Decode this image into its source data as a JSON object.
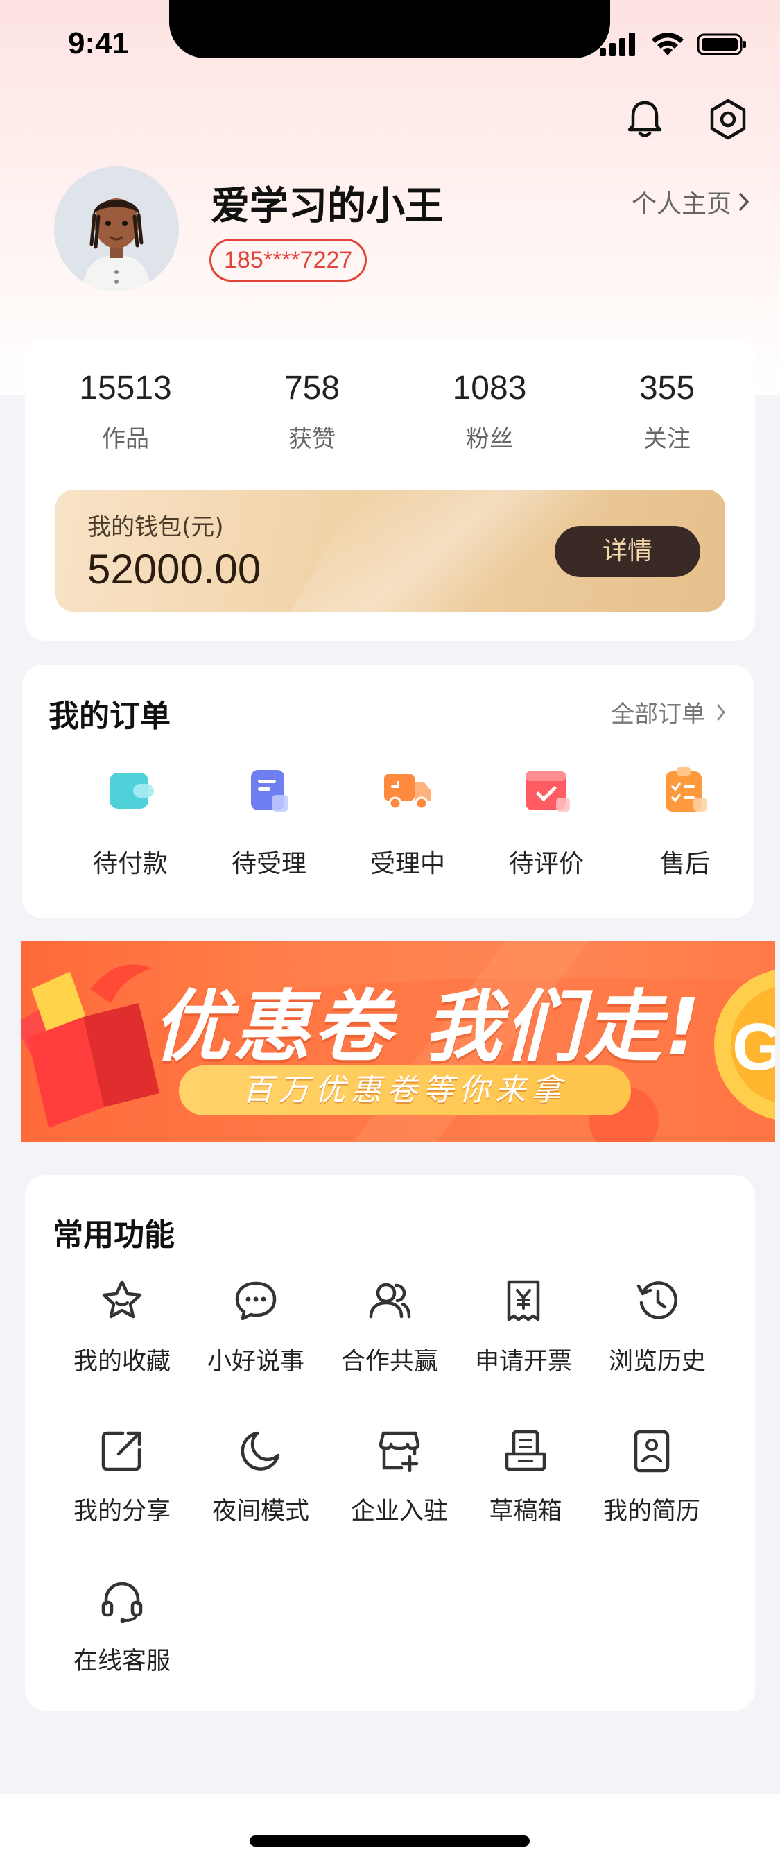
{
  "status_bar": {
    "time": "9:41"
  },
  "header": {
    "bell_icon": "bell-icon",
    "settings_icon": "settings-icon"
  },
  "profile": {
    "username": "爱学习的小王",
    "phone": "185****7227",
    "home_link": "个人主页"
  },
  "stats": [
    {
      "value": "15513",
      "label": "作品"
    },
    {
      "value": "758",
      "label": "获赞"
    },
    {
      "value": "1083",
      "label": "粉丝"
    },
    {
      "value": "355",
      "label": "关注"
    }
  ],
  "wallet": {
    "label": "我的钱包(元)",
    "amount": "52000.00",
    "button": "详情"
  },
  "orders": {
    "title": "我的订单",
    "link": "全部订单",
    "items": [
      {
        "label": "待付款",
        "icon": "wallet-icon",
        "color": "#4fd1d9"
      },
      {
        "label": "待受理",
        "icon": "document-icon",
        "color": "#6f7ef0"
      },
      {
        "label": "受理中",
        "icon": "truck-icon",
        "color": "#ff8a3d"
      },
      {
        "label": "待评价",
        "icon": "rating-box-icon",
        "color": "#ff5b63"
      },
      {
        "label": "售后",
        "icon": "clipboard-icon",
        "color": "#ff9a3c"
      }
    ]
  },
  "banner": {
    "title": "优惠卷 我们走!",
    "subtitle": "百万优惠卷等你来拿"
  },
  "functions": {
    "title": "常用功能",
    "items": [
      {
        "label": "我的收藏",
        "icon": "star-icon"
      },
      {
        "label": "小好说事",
        "icon": "chat-bubble-icon"
      },
      {
        "label": "合作共赢",
        "icon": "users-icon"
      },
      {
        "label": "申请开票",
        "icon": "invoice-icon"
      },
      {
        "label": "浏览历史",
        "icon": "history-icon"
      },
      {
        "label": "我的分享",
        "icon": "share-icon"
      },
      {
        "label": "夜间模式",
        "icon": "moon-icon"
      },
      {
        "label": "企业入驻",
        "icon": "store-icon"
      },
      {
        "label": "草稿箱",
        "icon": "drafts-icon"
      },
      {
        "label": "我的简历",
        "icon": "resume-icon"
      },
      {
        "label": "在线客服",
        "icon": "headset-icon"
      }
    ]
  }
}
